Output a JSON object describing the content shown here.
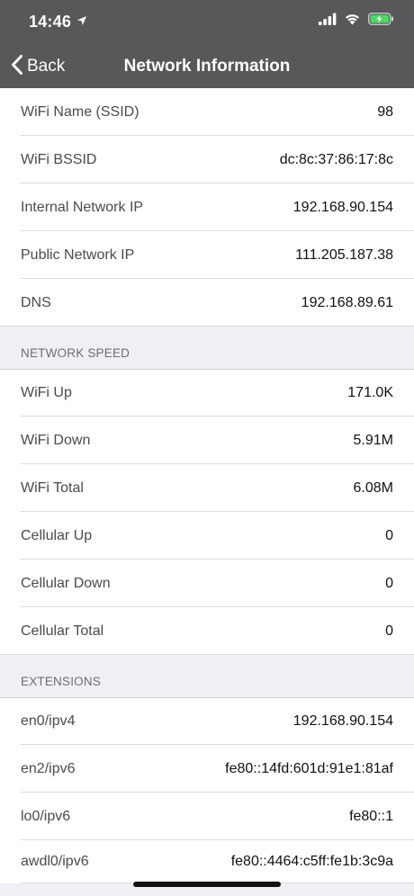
{
  "status_bar": {
    "time": "14:46"
  },
  "nav": {
    "back_label": "Back",
    "title": "Network Information"
  },
  "network_info": [
    {
      "label": "WiFi Name (SSID)",
      "value": "98"
    },
    {
      "label": "WiFi BSSID",
      "value": "dc:8c:37:86:17:8c"
    },
    {
      "label": "Internal Network IP",
      "value": "192.168.90.154"
    },
    {
      "label": "Public Network IP",
      "value": "111.205.187.38"
    },
    {
      "label": "DNS",
      "value": "192.168.89.61"
    }
  ],
  "network_speed": {
    "header": "NETWORK SPEED",
    "rows": [
      {
        "label": "WiFi Up",
        "value": "171.0K"
      },
      {
        "label": "WiFi Down",
        "value": "5.91M"
      },
      {
        "label": "WiFi Total",
        "value": "6.08M"
      },
      {
        "label": "Cellular Up",
        "value": "0"
      },
      {
        "label": "Cellular Down",
        "value": "0"
      },
      {
        "label": "Cellular Total",
        "value": "0"
      }
    ]
  },
  "extensions": {
    "header": "EXTENSIONS",
    "rows": [
      {
        "label": "en0/ipv4",
        "value": "192.168.90.154"
      },
      {
        "label": "en2/ipv6",
        "value": "fe80::14fd:601d:91e1:81af"
      },
      {
        "label": "lo0/ipv6",
        "value": "fe80::1"
      },
      {
        "label": "awdl0/ipv6",
        "value": "fe80::4464:c5ff:fe1b:3c9a"
      }
    ]
  },
  "colors": {
    "nav_background": "#58585a",
    "page_background": "#efeff4",
    "battery_fill": "#4cd964"
  },
  "icons": [
    "location-arrow-icon",
    "cellular-signal-icon",
    "wifi-icon",
    "battery-charging-icon",
    "chevron-left-icon"
  ]
}
